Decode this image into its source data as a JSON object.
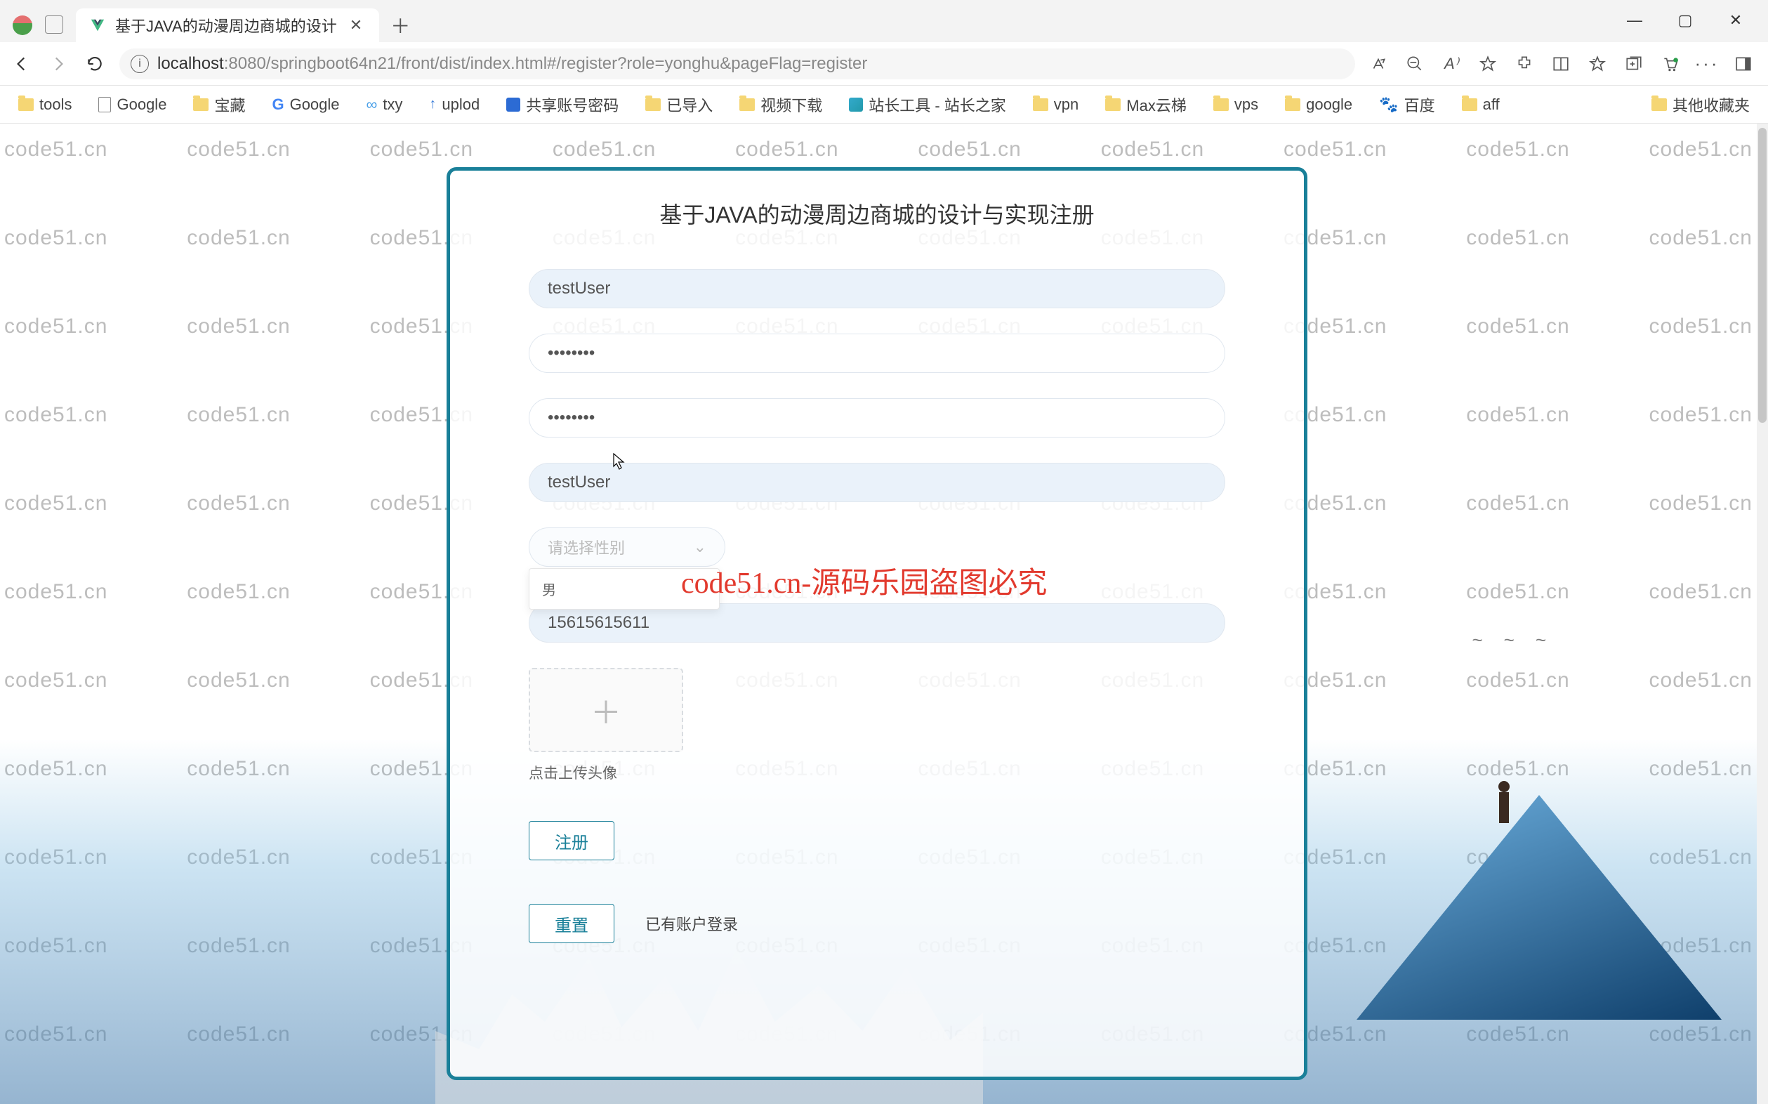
{
  "browser": {
    "tab_title": "基于JAVA的动漫周边商城的设计",
    "url_host": "localhost",
    "url_path": ":8080/springboot64n21/front/dist/index.html#/register?role=yonghu&pageFlag=register",
    "window_controls": {
      "minimize": "—",
      "maximize": "▢",
      "close": "✕"
    }
  },
  "bookmarks": [
    {
      "label": "tools",
      "icon": "folder"
    },
    {
      "label": "Google",
      "icon": "page"
    },
    {
      "label": "宝藏",
      "icon": "folder"
    },
    {
      "label": "Google",
      "icon": "g"
    },
    {
      "label": "txy",
      "icon": "cloud"
    },
    {
      "label": "uplod",
      "icon": "up"
    },
    {
      "label": "共享账号密码",
      "icon": "app"
    },
    {
      "label": "已导入",
      "icon": "folder"
    },
    {
      "label": "视频下载",
      "icon": "folder"
    },
    {
      "label": "站长工具 - 站长之家",
      "icon": "tool"
    },
    {
      "label": "vpn",
      "icon": "folder"
    },
    {
      "label": "Max云梯",
      "icon": "folder"
    },
    {
      "label": "vps",
      "icon": "folder"
    },
    {
      "label": "google",
      "icon": "folder"
    },
    {
      "label": "百度",
      "icon": "baidu"
    },
    {
      "label": "aff",
      "icon": "folder"
    }
  ],
  "bookmarks_overflow": "其他收藏夹",
  "page": {
    "title": "基于JAVA的动漫周边商城的设计与实现注册",
    "fields": {
      "username_value": "testUser",
      "password_value": "••••••••",
      "password2_value": "••••••••",
      "nickname_value": "testUser",
      "gender_placeholder": "请选择性别",
      "gender_option_1": "男",
      "phone_value": "15615615611"
    },
    "upload": {
      "plus": "＋",
      "hint": "点击上传头像"
    },
    "buttons": {
      "register": "注册",
      "reset": "重置",
      "login_link": "已有账户登录"
    },
    "watermark_text": "code51.cn",
    "red_watermark": "code51.cn-源码乐园盗图必究"
  }
}
